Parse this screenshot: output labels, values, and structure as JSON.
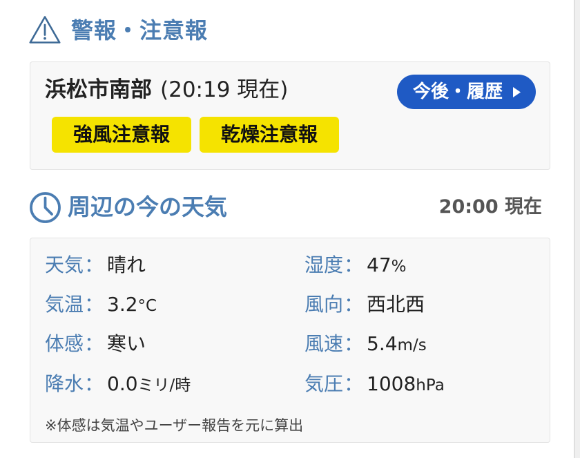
{
  "colors": {
    "accent": "#4b7db2",
    "button": "#1f5ac4",
    "badge_yellow": "#f5e300",
    "text_dark": "#222222",
    "box_bg": "#f8f8f8"
  },
  "icons": {
    "warnings": "warning-triangle-icon",
    "weather": "clock-icon",
    "history_button": "arrow-right-icon"
  },
  "warnings": {
    "title": "警報・注意報",
    "area_name": "浜松市南部",
    "area_time": "(20:19 現在)",
    "history_button_label": "今後・履歴",
    "badges": [
      "強風注意報",
      "乾燥注意報"
    ]
  },
  "weather": {
    "title": "周辺の今の天気",
    "as_of": "20:00 現在",
    "separator": "：",
    "items": [
      {
        "label": "天気",
        "value": "晴れ",
        "unit": ""
      },
      {
        "label": "湿度",
        "value": "47",
        "unit": "%"
      },
      {
        "label": "気温",
        "value": "3.2",
        "unit": "°C"
      },
      {
        "label": "風向",
        "value": "西北西",
        "unit": ""
      },
      {
        "label": "体感",
        "value": "寒い",
        "unit": ""
      },
      {
        "label": "風速",
        "value": "5.4",
        "unit": "m/s"
      },
      {
        "label": "降水",
        "value": "0.0",
        "unit": "ミリ/時"
      },
      {
        "label": "気圧",
        "value": "1008",
        "unit": "hPa"
      }
    ],
    "footnote": "※体感は気温やユーザー報告を元に算出"
  }
}
